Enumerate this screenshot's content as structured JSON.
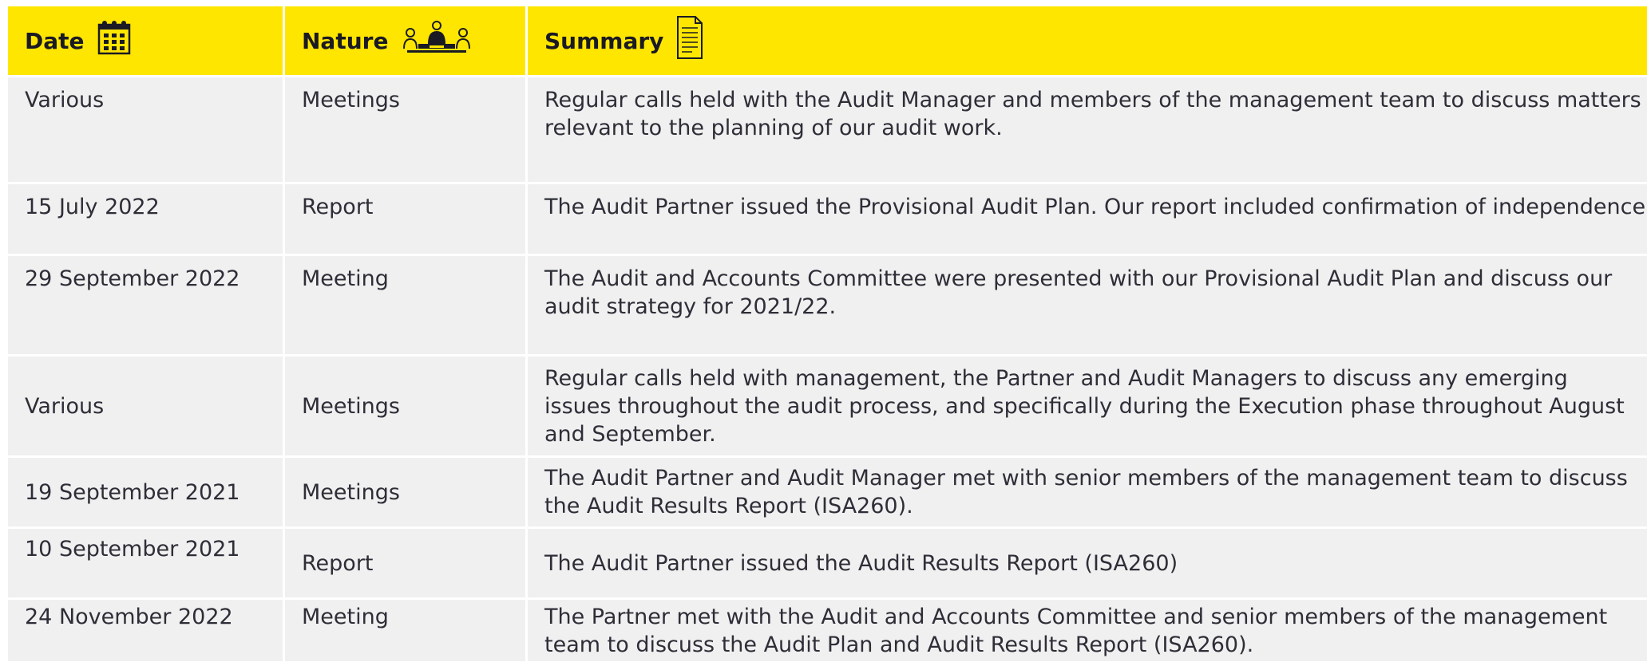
{
  "header": {
    "date_label": "Date",
    "nature_label": "Nature",
    "summary_label": "Summary",
    "date_icon": "calendar-icon",
    "nature_icon": "meeting-icon",
    "summary_icon": "document-icon"
  },
  "rows": [
    {
      "date": "Various",
      "nature": "Meetings",
      "summary": "Regular calls held with the Audit Manager and members of the management team to discuss matters relevant to the planning of our audit work."
    },
    {
      "date": "15 July 2022",
      "nature": "Report",
      "summary": "The Audit Partner issued the Provisional Audit Plan. Our report included confirmation of independence."
    },
    {
      "date": "29 September 2022",
      "nature": "Meeting",
      "summary": "The Audit and Accounts Committee were presented with our Provisional Audit Plan and discuss our audit strategy for 2021/22."
    },
    {
      "date": "Various",
      "nature": "Meetings",
      "summary": "Regular calls held with management, the Partner and Audit Managers to discuss any emerging issues throughout the audit process, and specifically during the Execution phase throughout August and September."
    },
    {
      "date": "19 September 2021",
      "nature": "Meetings",
      "summary": "The Audit Partner and Audit Manager met with senior members of the management team to discuss the Audit Results Report (ISA260)."
    },
    {
      "date": "10 September 2021",
      "nature": "Report",
      "summary": "The Audit Partner issued the Audit Results Report (ISA260)"
    },
    {
      "date": "24 November 2022",
      "nature": "Meeting",
      "summary": "The Partner met with the Audit and Accounts Committee and senior members of the management team to discuss the Audit Plan and Audit Results Report (ISA260)."
    }
  ],
  "colors": {
    "header_bg": "#ffe600",
    "cell_bg": "#f0f0f0",
    "text": "#2e2e38"
  }
}
